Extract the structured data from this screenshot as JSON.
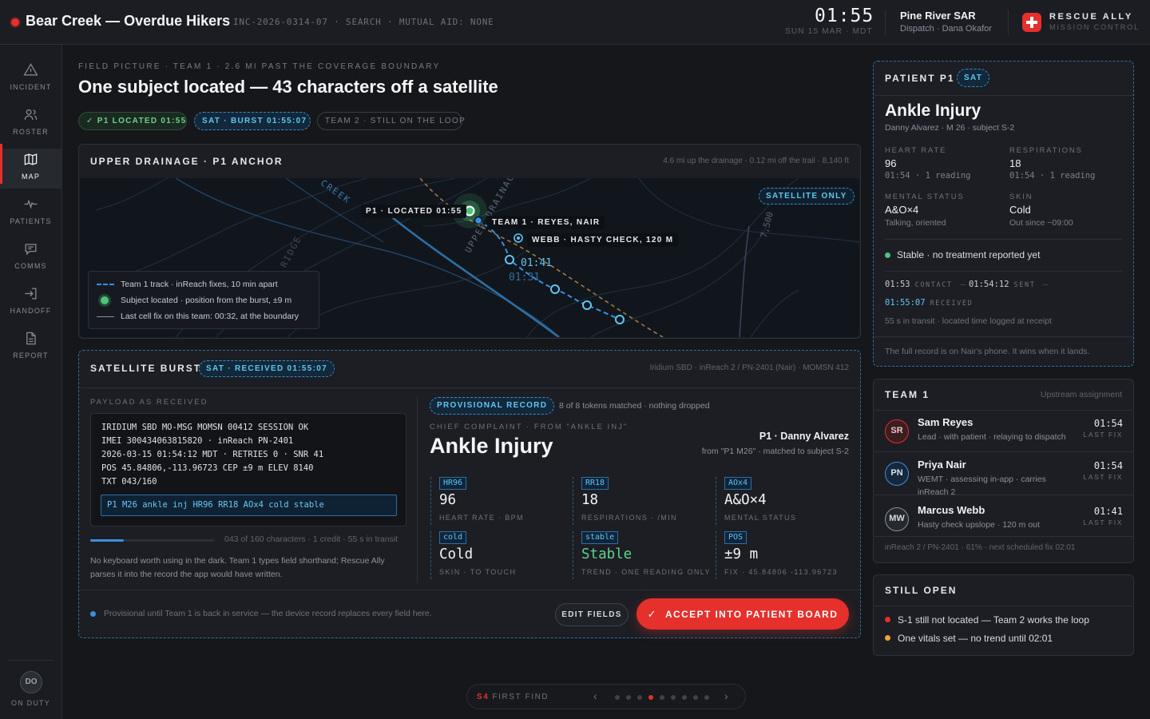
{
  "topbar": {
    "title": "Bear Creek — Overdue Hikers",
    "meta": "INC-2026-0314-07 · SEARCH · MUTUAL AID: NONE",
    "clock": "01:55",
    "date": "SUN 15 MAR · MDT",
    "org": "Pine River SAR",
    "dispatch": "Dispatch · Dana Okafor",
    "brand": "RESCUE ALLY",
    "brand_sub": "MISSION CONTROL"
  },
  "sidebar": {
    "items": [
      {
        "label": "INCIDENT",
        "icon": "warning-icon"
      },
      {
        "label": "ROSTER",
        "icon": "people-icon"
      },
      {
        "label": "MAP",
        "icon": "map-icon"
      },
      {
        "label": "PATIENTS",
        "icon": "pulse-icon"
      },
      {
        "label": "COMMS",
        "icon": "message-icon"
      },
      {
        "label": "HANDOFF",
        "icon": "handoff-icon"
      },
      {
        "label": "REPORT",
        "icon": "document-icon"
      }
    ],
    "active": "MAP",
    "duty_initials": "DO",
    "duty_label": "ON DUTY"
  },
  "header": {
    "eyebrow": "FIELD PICTURE · TEAM 1 · 2.6 MI PAST THE COVERAGE BOUNDARY",
    "headline": "One subject located — 43 characters off a satellite",
    "chips": [
      "✓ P1 LOCATED 01:55",
      "SAT · BURST 01:55:07",
      "TEAM 2 · STILL ON THE LOOP"
    ]
  },
  "map": {
    "title": "UPPER DRAINAGE · P1 ANCHOR",
    "note": "4.6 mi up the drainage · 0.12 mi off the trail · 8,140 ft",
    "sat_badge": "SATELLITE ONLY",
    "labels": {
      "creek": "CREEK",
      "ridge": "RIDGE",
      "drainage": "UPPER DRAINAGE",
      "contour": "7,500",
      "p1": "P1 · LOCATED 01:55",
      "team1": "TEAM 1 · REYES, NAIR",
      "webb": "WEBB · HASTY CHECK, 120 M",
      "fix_a": "01:41",
      "fix_b": "01:31"
    },
    "legend": [
      "Team 1 track · inReach fixes, 10 min apart",
      "Subject located · position from the burst, ±9 m",
      "Last cell fix on this team: 00:32, at the boundary"
    ]
  },
  "burst": {
    "title": "SATELLITE BURST",
    "chip": "SAT · RECEIVED 01:55:07",
    "note": "Iridium SBD · inReach 2 / PN-2401 (Nair) · MOMSN 412",
    "payload_label": "PAYLOAD AS RECEIVED",
    "payload_lines": [
      "IRIDIUM SBD MO-MSG MOMSN 00412 SESSION OK",
      "IMEI 300434063815820 · inReach PN-2401",
      "2026-03-15 01:54:12 MDT · RETRIES 0 · SNR 41",
      "POS 45.84806,-113.96723 CEP ±9 m ELEV 8140",
      "TXT 043/160"
    ],
    "payload_text": "P1 M26 ankle inj HR96 RR18 AOx4 cold stable",
    "progress": 0.27,
    "progress_text": "043 of 160 characters · 1 credit · 55 s in transit",
    "explainer": "No keyboard worth using in the dark. Team 1 types field shorthand; Rescue Ally parses it into the record the app would have written.",
    "provisional_chip": "PROVISIONAL RECORD",
    "tokens_note": "8 of 8 tokens matched · nothing dropped",
    "cc_label": "CHIEF COMPLAINT · FROM \"ANKLE INJ\"",
    "cc_value": "Ankle Injury",
    "who": "P1 · Danny Alvarez",
    "who_from": "from \"P1 M26\" · matched to subject S-2",
    "fields": [
      {
        "token": "HR96",
        "value": "96",
        "caption": "HEART RATE · BPM"
      },
      {
        "token": "RR18",
        "value": "18",
        "caption": "RESPIRATIONS · /MIN"
      },
      {
        "token": "AOx4",
        "value": "A&O×4",
        "caption": "MENTAL STATUS"
      },
      {
        "token": "cold",
        "value": "Cold",
        "caption": "SKIN · TO TOUCH"
      },
      {
        "token": "stable",
        "value": "Stable",
        "caption": "TREND · ONE READING ONLY"
      },
      {
        "token": "POS",
        "value": "±9 m",
        "caption": "FIX · 45.84806 -113.96723"
      }
    ],
    "footer_note": "Provisional until Team 1 is back in service — the device record replaces every field here.",
    "edit_label": "EDIT FIELDS",
    "accept_label": "ACCEPT INTO PATIENT BOARD"
  },
  "patient": {
    "head": "PATIENT P1",
    "chip": "SAT",
    "complaint": "Ankle Injury",
    "sub": "Danny Alvarez · M 26 · subject S-2",
    "vitals": [
      {
        "label": "HEART RATE",
        "value": "96",
        "sub": "01:54 · 1 reading"
      },
      {
        "label": "RESPIRATIONS",
        "value": "18",
        "sub": "01:54 · 1 reading"
      },
      {
        "label": "MENTAL STATUS",
        "value": "A&O×4",
        "sub": "Talking, oriented"
      },
      {
        "label": "SKIN",
        "value": "Cold",
        "sub": "Out since ~09:00"
      }
    ],
    "status": "Stable · no treatment reported yet",
    "timeline": {
      "contact_time": "01:53",
      "contact_lbl": "CONTACT",
      "sent_time": "01:54:12",
      "sent_lbl": "SENT",
      "received_time": "01:55:07",
      "received_lbl": "RECEIVED",
      "transit": "55 s in transit · located time logged at receipt"
    },
    "footer": "The full record is on Nair's phone. It wins when it lands."
  },
  "team": {
    "head": "TEAM 1",
    "note": "Upstream assignment",
    "members": [
      {
        "initials": "SR",
        "name": "Sam Reyes",
        "role": "Lead · with patient · relaying to dispatch",
        "time": "01:54",
        "lf": "LAST FIX"
      },
      {
        "initials": "PN",
        "name": "Priya Nair",
        "role": "WEMT · assessing in-app · carries inReach 2",
        "time": "01:54",
        "lf": "LAST FIX"
      },
      {
        "initials": "MW",
        "name": "Marcus Webb",
        "role": "Hasty check upslope · 120 m out",
        "time": "01:41",
        "lf": "LAST FIX"
      }
    ],
    "footer": "inReach 2 / PN-2401 · 61% · next scheduled fix 02:01"
  },
  "still_open": {
    "head": "STILL OPEN",
    "items": [
      {
        "text": "S-1 still not located — Team 2 works the loop",
        "color": "#e5302c"
      },
      {
        "text": "One vitals set — no trend until 02:01",
        "color": "#f0a431"
      }
    ]
  },
  "pager": {
    "step": "S4",
    "label": "FIRST FIND",
    "total": 9,
    "current": 4
  },
  "colors": {
    "accent": "#e5302c",
    "sat_blue": "#5ec7f2",
    "ok_green": "#4cc47b",
    "warn_amber": "#f0a431"
  }
}
